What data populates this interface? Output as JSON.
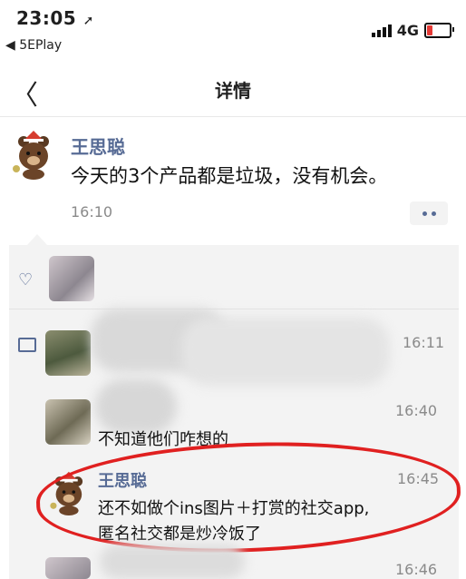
{
  "status_bar": {
    "time": "23:05",
    "location_glyph": "➚",
    "back_app": "◀ 5EPlay",
    "network": "4G",
    "icons": [
      "signal-icon",
      "battery-icon"
    ],
    "battery_low_color": "#e53935"
  },
  "nav": {
    "back_glyph": "〈",
    "title": "详情"
  },
  "post": {
    "author": "王思聪",
    "text": "今天的3个产品都是垃圾，没有机会。",
    "time": "16:10"
  },
  "colors": {
    "link_blue": "#576b95",
    "panel_bg": "#f3f3f3",
    "annotation_red": "#e02020"
  },
  "comments": [
    {
      "time": "16:11",
      "text": ""
    },
    {
      "time": "16:40",
      "text": "不知道他们咋想的"
    },
    {
      "author": "王思聪",
      "time": "16:45",
      "line1": "还不如做个ins图片＋打赏的社交app,",
      "line2": "匿名社交都是炒冷饭了"
    },
    {
      "time": "16:46",
      "text": ""
    }
  ]
}
